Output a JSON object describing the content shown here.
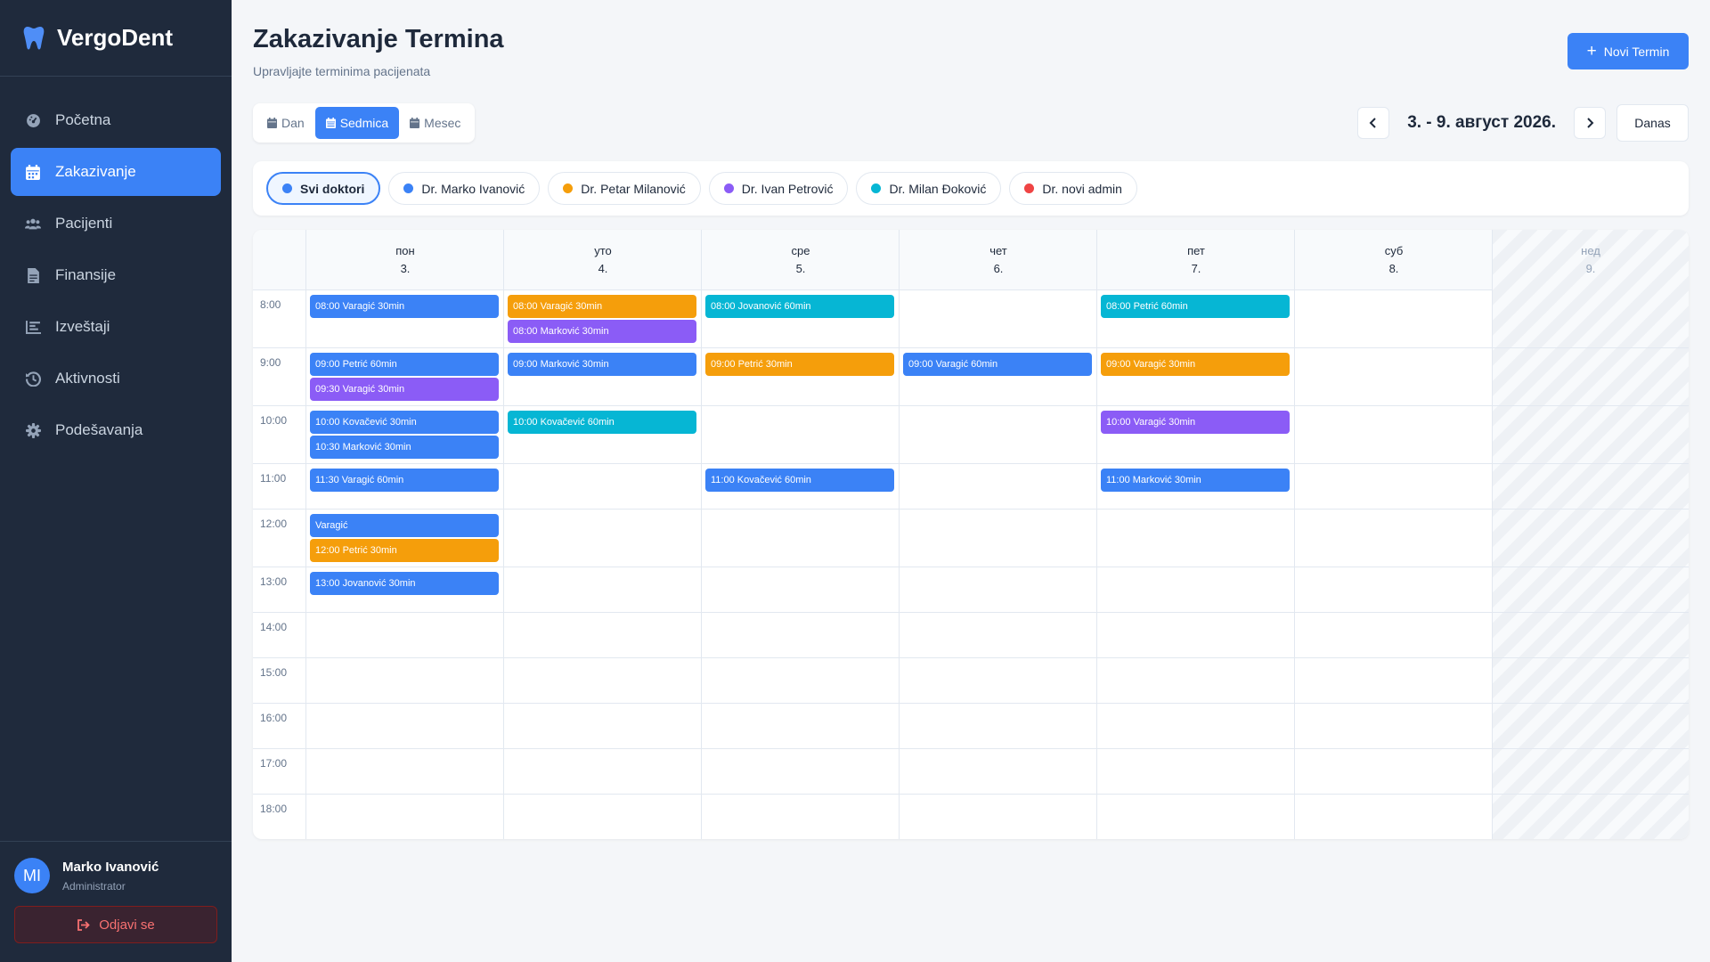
{
  "app": {
    "name": "VergoDent"
  },
  "sidebar": {
    "items": [
      {
        "label": "Početna",
        "icon": "dashboard-icon"
      },
      {
        "label": "Zakazivanje",
        "icon": "calendar-icon",
        "active": true
      },
      {
        "label": "Pacijenti",
        "icon": "users-icon"
      },
      {
        "label": "Finansije",
        "icon": "invoice-icon"
      },
      {
        "label": "Izveštaji",
        "icon": "chart-icon"
      },
      {
        "label": "Aktivnosti",
        "icon": "history-icon"
      },
      {
        "label": "Podešavanja",
        "icon": "gear-icon"
      }
    ]
  },
  "user": {
    "initials": "MI",
    "name": "Marko Ivanović",
    "role": "Administrator",
    "logout_label": "Odjavi se"
  },
  "header": {
    "title": "Zakazivanje Termina",
    "subtitle": "Upravljajte terminima pacijenata",
    "new_button": "Novi Termin"
  },
  "views": {
    "day": "Dan",
    "week": "Sedmica",
    "month": "Mesec",
    "active": "week"
  },
  "date_nav": {
    "range": "3. - 9. август 2026.",
    "today": "Danas"
  },
  "filters": [
    {
      "label": "Svi doktori",
      "color": "#3b82f6",
      "active": true
    },
    {
      "label": "Dr. Marko Ivanović",
      "color": "#3b82f6"
    },
    {
      "label": "Dr. Petar Milanović",
      "color": "#f59e0b"
    },
    {
      "label": "Dr. Ivan Petrović",
      "color": "#8b5cf6"
    },
    {
      "label": "Dr. Milan Đoković",
      "color": "#06b6d4"
    },
    {
      "label": "Dr. novi admin",
      "color": "#ef4444"
    }
  ],
  "colors": {
    "blue": "#3b82f6",
    "orange": "#f59e0b",
    "purple": "#8b5cf6",
    "cyan": "#06b6d4",
    "red": "#ef4444"
  },
  "calendar": {
    "days": [
      {
        "name": "пон",
        "num": "3."
      },
      {
        "name": "уто",
        "num": "4."
      },
      {
        "name": "сре",
        "num": "5."
      },
      {
        "name": "чет",
        "num": "6."
      },
      {
        "name": "пет",
        "num": "7."
      },
      {
        "name": "суб",
        "num": "8."
      },
      {
        "name": "нед",
        "num": "9."
      }
    ],
    "hours": [
      "8:00",
      "9:00",
      "10:00",
      "11:00",
      "12:00",
      "13:00",
      "14:00",
      "15:00",
      "16:00",
      "17:00",
      "18:00"
    ],
    "events": [
      {
        "day": 0,
        "hour": 0,
        "slot": 0,
        "label": "08:00 Varagić 30min",
        "color": "blue"
      },
      {
        "day": 0,
        "hour": 1,
        "slot": 0,
        "label": "09:00 Petrić 60min",
        "color": "blue"
      },
      {
        "day": 0,
        "hour": 1,
        "slot": 1,
        "label": "09:30 Varagić 30min",
        "color": "purple"
      },
      {
        "day": 0,
        "hour": 2,
        "slot": 0,
        "label": "10:00 Kovačević 30min",
        "color": "blue"
      },
      {
        "day": 0,
        "hour": 2,
        "slot": 1,
        "label": "10:30 Marković 30min",
        "color": "blue"
      },
      {
        "day": 0,
        "hour": 3,
        "slot": 0,
        "label": "11:30 Varagić 60min",
        "color": "blue"
      },
      {
        "day": 0,
        "hour": 4,
        "slot": 0,
        "label": "Varagić",
        "color": "blue"
      },
      {
        "day": 0,
        "hour": 4,
        "slot": 1,
        "label": "12:00 Petrić 30min",
        "color": "orange"
      },
      {
        "day": 0,
        "hour": 5,
        "slot": 0,
        "label": "13:00 Jovanović 30min",
        "color": "blue"
      },
      {
        "day": 1,
        "hour": 0,
        "slot": 0,
        "label": "08:00 Varagić 30min",
        "color": "orange"
      },
      {
        "day": 1,
        "hour": 0,
        "slot": 1,
        "label": "08:00 Marković 30min",
        "color": "purple"
      },
      {
        "day": 1,
        "hour": 1,
        "slot": 0,
        "label": "09:00 Marković 30min",
        "color": "blue"
      },
      {
        "day": 1,
        "hour": 2,
        "slot": 0,
        "label": "10:00 Kovačević 60min",
        "color": "cyan"
      },
      {
        "day": 2,
        "hour": 0,
        "slot": 0,
        "label": "08:00 Jovanović 60min",
        "color": "cyan"
      },
      {
        "day": 2,
        "hour": 1,
        "slot": 0,
        "label": "09:00 Petrić 30min",
        "color": "orange"
      },
      {
        "day": 2,
        "hour": 3,
        "slot": 0,
        "label": "11:00 Kovačević 60min",
        "color": "blue"
      },
      {
        "day": 3,
        "hour": 1,
        "slot": 0,
        "label": "09:00 Varagić 60min",
        "color": "blue"
      },
      {
        "day": 4,
        "hour": 0,
        "slot": 0,
        "label": "08:00 Petrić 60min",
        "color": "cyan"
      },
      {
        "day": 4,
        "hour": 1,
        "slot": 0,
        "label": "09:00 Varagić 30min",
        "color": "orange"
      },
      {
        "day": 4,
        "hour": 2,
        "slot": 0,
        "label": "10:00 Varagić 30min",
        "color": "purple"
      },
      {
        "day": 4,
        "hour": 3,
        "slot": 0,
        "label": "11:00 Marković 30min",
        "color": "blue"
      }
    ]
  }
}
